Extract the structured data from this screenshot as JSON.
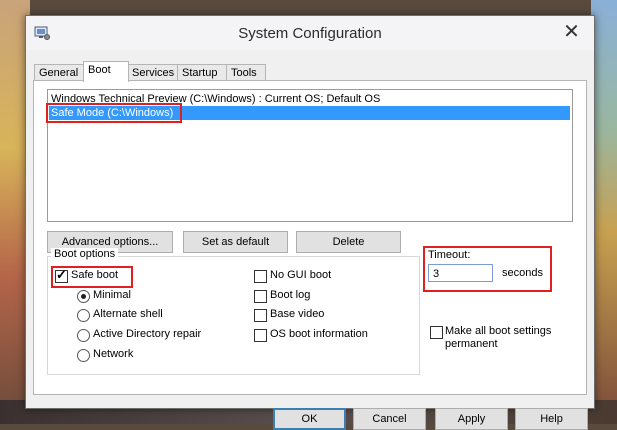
{
  "window": {
    "title": "System Configuration",
    "close_symbol": "✕"
  },
  "tabs": [
    {
      "label": "General",
      "active": false
    },
    {
      "label": "Boot",
      "active": true
    },
    {
      "label": "Services",
      "active": false
    },
    {
      "label": "Startup",
      "active": false
    },
    {
      "label": "Tools",
      "active": false
    }
  ],
  "os_list": [
    {
      "label": "Windows Technical Preview (C:\\Windows) : Current OS; Default OS",
      "selected": false
    },
    {
      "label": "Safe Mode (C:\\Windows)",
      "selected": true
    }
  ],
  "actions": {
    "advanced_label": "Advanced options...",
    "default_label": "Set as default",
    "delete_label": "Delete"
  },
  "boot_options": {
    "group_label": "Boot options",
    "safe_boot": {
      "label": "Safe boot",
      "checked": true
    },
    "radios": [
      {
        "label": "Minimal",
        "checked": true
      },
      {
        "label": "Alternate shell",
        "checked": false
      },
      {
        "label": "Active Directory repair",
        "checked": false
      },
      {
        "label": "Network",
        "checked": false
      }
    ],
    "checkboxes": [
      {
        "label": "No GUI boot",
        "checked": false
      },
      {
        "label": "Boot log",
        "checked": false
      },
      {
        "label": "Base video",
        "checked": false
      },
      {
        "label": "OS boot information",
        "checked": false
      }
    ]
  },
  "timeout": {
    "label": "Timeout:",
    "value": "3",
    "unit": "seconds"
  },
  "permanent": {
    "label_line1": "Make all boot settings",
    "label_line2": "permanent",
    "checked": false
  },
  "footer": {
    "ok_label": "OK",
    "cancel_label": "Cancel",
    "apply_label": "Apply",
    "help_label": "Help"
  },
  "highlight_color": "#e02020",
  "selection_color": "#3399ff"
}
